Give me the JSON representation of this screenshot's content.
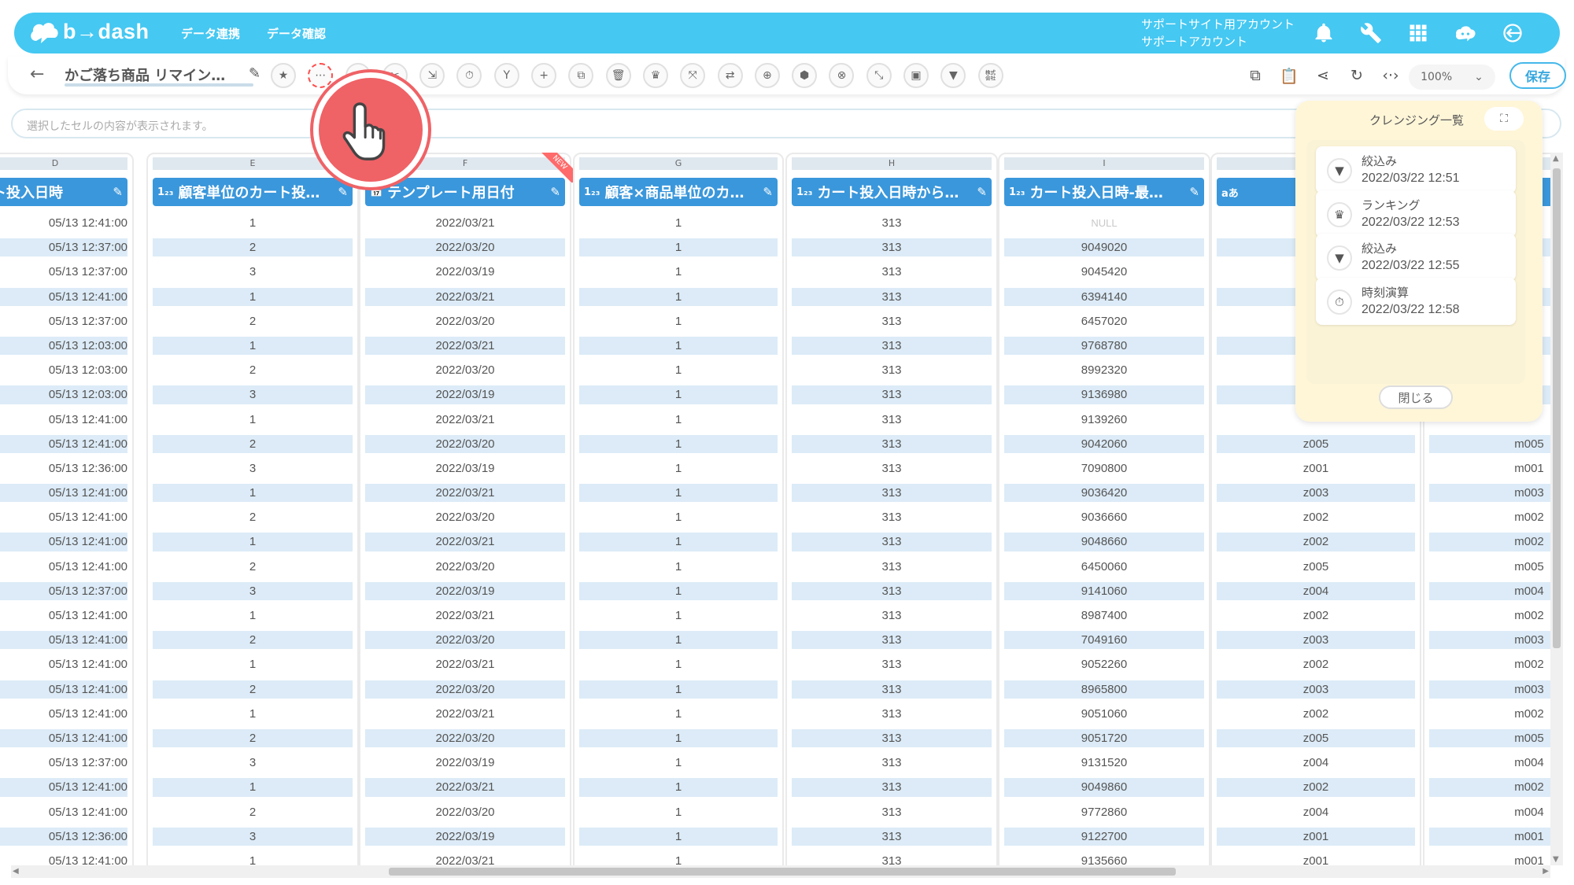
{
  "header": {
    "logo_text": "b→dash",
    "nav": [
      "データ連携",
      "データ確認"
    ],
    "account_line1": "サポートサイト用アカウント",
    "account_line2": "サポートアカウント",
    "icons": [
      "bell-icon",
      "wrench-icon",
      "grid-menu-icon",
      "chat-robot-icon",
      "logout-icon"
    ]
  },
  "toolbar": {
    "back_label": "←",
    "recipe_title": "かご落ち商品 リマイン…",
    "tools": [
      "★",
      "⋯",
      "≡",
      "✂",
      "⇲",
      "⏱",
      "Y",
      "+",
      "⧉",
      "🗑",
      "♛",
      "⤧",
      "⇄",
      "⊕",
      "⬢",
      "⊗",
      "⤡",
      "▣",
      "▼",
      "㍿"
    ],
    "zoom": "100%",
    "save_label": "保存"
  },
  "formula_bar": {
    "placeholder": "選択したセルの内容が表示されます。"
  },
  "columns": [
    {
      "letter": "D",
      "type": "",
      "title": "ト投入日時"
    },
    {
      "letter": "E",
      "type": "1₂₃",
      "title": "顧客単位のカート投…"
    },
    {
      "letter": "F",
      "type": "📅",
      "title": "テンプレート用日付",
      "new_tag": "NEW"
    },
    {
      "letter": "G",
      "type": "1₂₃",
      "title": "顧客×商品単位のカ…"
    },
    {
      "letter": "H",
      "type": "1₂₃",
      "title": "カート投入日時から…"
    },
    {
      "letter": "I",
      "type": "1₂₃",
      "title": "カート投入日時-最…"
    },
    {
      "letter": "",
      "type": "aあ",
      "title": ""
    },
    {
      "letter": "",
      "type": "",
      "title": ""
    }
  ],
  "rows": [
    [
      "05/13 12:41:00",
      "1",
      "2022/03/21",
      "1",
      "313",
      "NULL",
      "",
      ""
    ],
    [
      "05/13 12:37:00",
      "2",
      "2022/03/20",
      "1",
      "313",
      "9049020",
      "",
      ""
    ],
    [
      "05/13 12:37:00",
      "3",
      "2022/03/19",
      "1",
      "313",
      "9045420",
      "",
      ""
    ],
    [
      "05/13 12:41:00",
      "1",
      "2022/03/21",
      "1",
      "313",
      "6394140",
      "",
      ""
    ],
    [
      "05/13 12:37:00",
      "2",
      "2022/03/20",
      "1",
      "313",
      "6457020",
      "",
      ""
    ],
    [
      "05/13 12:03:00",
      "1",
      "2022/03/21",
      "1",
      "313",
      "9768780",
      "",
      ""
    ],
    [
      "05/13 12:03:00",
      "2",
      "2022/03/20",
      "1",
      "313",
      "8992320",
      "",
      ""
    ],
    [
      "05/13 12:03:00",
      "3",
      "2022/03/19",
      "1",
      "313",
      "9136980",
      "",
      ""
    ],
    [
      "05/13 12:41:00",
      "1",
      "2022/03/21",
      "1",
      "313",
      "9139260",
      "",
      ""
    ],
    [
      "05/13 12:41:00",
      "2",
      "2022/03/20",
      "1",
      "313",
      "9042060",
      "z005",
      "m005"
    ],
    [
      "05/13 12:36:00",
      "3",
      "2022/03/19",
      "1",
      "313",
      "7090800",
      "z001",
      "m001"
    ],
    [
      "05/13 12:41:00",
      "1",
      "2022/03/21",
      "1",
      "313",
      "9036420",
      "z003",
      "m003"
    ],
    [
      "05/13 12:41:00",
      "2",
      "2022/03/20",
      "1",
      "313",
      "9036660",
      "z002",
      "m002"
    ],
    [
      "05/13 12:41:00",
      "1",
      "2022/03/21",
      "1",
      "313",
      "9048660",
      "z002",
      "m002"
    ],
    [
      "05/13 12:41:00",
      "2",
      "2022/03/20",
      "1",
      "313",
      "6450060",
      "z005",
      "m005"
    ],
    [
      "05/13 12:37:00",
      "3",
      "2022/03/19",
      "1",
      "313",
      "9141060",
      "z004",
      "m004"
    ],
    [
      "05/13 12:41:00",
      "1",
      "2022/03/21",
      "1",
      "313",
      "8987400",
      "z002",
      "m002"
    ],
    [
      "05/13 12:41:00",
      "2",
      "2022/03/20",
      "1",
      "313",
      "7049160",
      "z003",
      "m003"
    ],
    [
      "05/13 12:41:00",
      "1",
      "2022/03/21",
      "1",
      "313",
      "9052260",
      "z002",
      "m002"
    ],
    [
      "05/13 12:41:00",
      "2",
      "2022/03/20",
      "1",
      "313",
      "8965800",
      "z003",
      "m003"
    ],
    [
      "05/13 12:41:00",
      "1",
      "2022/03/21",
      "1",
      "313",
      "9051060",
      "z002",
      "m002"
    ],
    [
      "05/13 12:41:00",
      "2",
      "2022/03/20",
      "1",
      "313",
      "9051720",
      "z005",
      "m005"
    ],
    [
      "05/13 12:37:00",
      "3",
      "2022/03/19",
      "1",
      "313",
      "9131520",
      "z004",
      "m004"
    ],
    [
      "05/13 12:41:00",
      "1",
      "2022/03/21",
      "1",
      "313",
      "9049860",
      "z002",
      "m002"
    ],
    [
      "05/13 12:41:00",
      "2",
      "2022/03/20",
      "1",
      "313",
      "9772860",
      "z004",
      "m004"
    ],
    [
      "05/13 12:36:00",
      "3",
      "2022/03/19",
      "1",
      "313",
      "9122700",
      "z001",
      "m001"
    ],
    [
      "05/13 12:41:00",
      "1",
      "2022/03/21",
      "1",
      "313",
      "9135660",
      "z001",
      "m001"
    ]
  ],
  "cleansing_panel": {
    "title": "クレンジング一覧",
    "items": [
      {
        "name": "絞込み",
        "date": "2022/03/22 12:51",
        "icon": "filter-icon",
        "glyph": "▼"
      },
      {
        "name": "ランキング",
        "date": "2022/03/22 12:53",
        "icon": "crown-icon",
        "glyph": "♛"
      },
      {
        "name": "絞込み",
        "date": "2022/03/22 12:55",
        "icon": "filter-icon",
        "glyph": "▼"
      },
      {
        "name": "時刻演算",
        "date": "2022/03/22 12:58",
        "icon": "timer-icon",
        "glyph": "⏱"
      }
    ],
    "close_label": "閉じる"
  },
  "colors": {
    "header": "#45c8f2",
    "column_header": "#3a97db",
    "row_stripe": "#dcebf7",
    "panel": "#fff6d8",
    "pointer": "#ef6266"
  }
}
